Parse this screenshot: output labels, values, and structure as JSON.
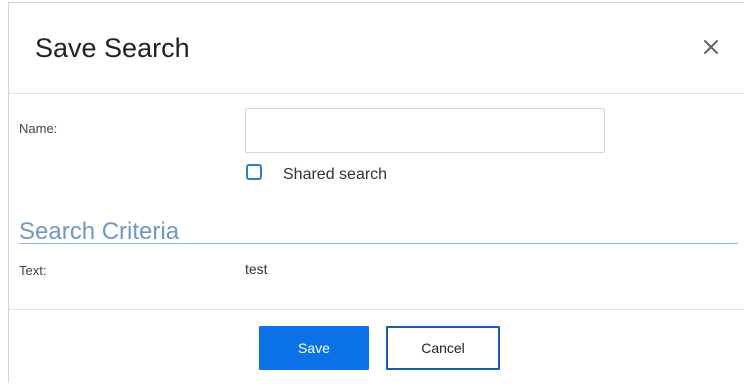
{
  "dialog": {
    "title": "Save Search",
    "close_icon": "close-icon"
  },
  "form": {
    "name_label": "Name:",
    "name_value": "",
    "name_placeholder": "",
    "shared_label": "Shared search",
    "shared_checked": false
  },
  "criteria": {
    "section_title": "Search Criteria",
    "text_label": "Text:",
    "text_value": "test"
  },
  "footer": {
    "save_label": "Save",
    "cancel_label": "Cancel"
  },
  "colors": {
    "primary_button": "#0a72e6",
    "section_title": "#6f98c8",
    "checkbox_border": "#2e7bd6"
  }
}
